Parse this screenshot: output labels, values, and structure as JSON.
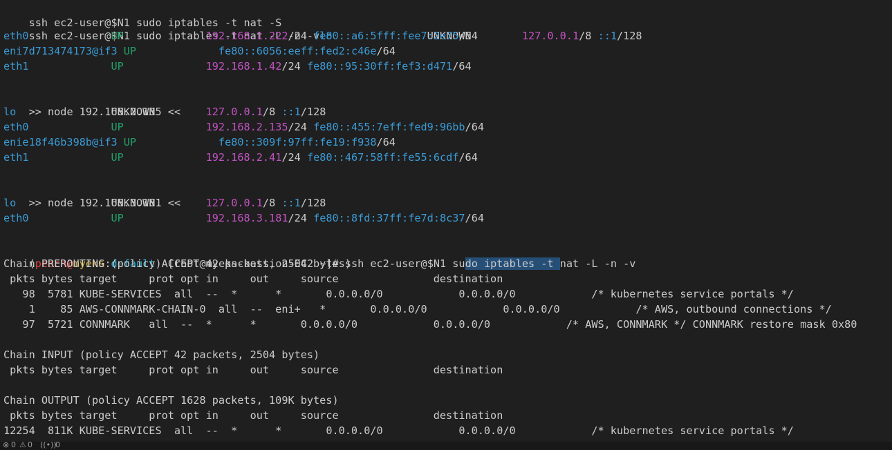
{
  "terminal": {
    "lines": [
      {
        "text": "ssh ec2-user@$N1 sudo iptables -t nat -S"
      },
      {
        "text": "ssh ec2-user@$N1 sudo iptables -t nat -L -n -v"
      },
      {
        "text": "eth0"
      },
      {
        "text": "eni7d713474173@if3"
      },
      {
        "text": "eth1"
      },
      {
        "text": ""
      },
      {
        "text": ">> node 192.168.2.135 <<"
      },
      {
        "text": "lo"
      },
      {
        "text": "eth0"
      },
      {
        "text": "enie18f46b398b@if3"
      },
      {
        "text": "eth1"
      },
      {
        "text": ""
      },
      {
        "text": ">> node 192.168.3.181 <<"
      },
      {
        "text": "lo"
      },
      {
        "text": "eth0"
      },
      {
        "text": ""
      },
      {
        "text": "(peach@myeks:default) [root@myeks-bastion-EC2 ~]# ssh ec2-user@$N1 sudo iptables -t nat -L -n -v"
      },
      {
        "text": "Chain PREROUTING (policy ACCEPT 42 packets, 2504 bytes)"
      },
      {
        "text": " pkts bytes target     prot opt in     out     source               destination"
      },
      {
        "text": "   98  5781 KUBE-SERVICES  all  --  *      *       0.0.0.0/0            0.0.0.0/0            /* kubernetes service portals */"
      },
      {
        "text": "    1    85 AWS-CONNMARK-CHAIN-0  all  --  eni+   *       0.0.0.0/0            0.0.0.0/0            /* AWS, outbound connections */"
      },
      {
        "text": "   97  5721 CONNMARK   all  --  *      *       0.0.0.0/0            0.0.0.0/0            /* AWS, CONNMARK */ CONNMARK restore mask 0x80"
      },
      {
        "text": ""
      },
      {
        "text": "Chain INPUT (policy ACCEPT 42 packets, 2504 bytes)"
      },
      {
        "text": " pkts bytes target     prot opt in     out     source               destination"
      },
      {
        "text": ""
      },
      {
        "text": "Chain OUTPUT (policy ACCEPT 1628 packets, 109K bytes)"
      },
      {
        "text": " pkts bytes target     prot opt in     out     source               destination"
      },
      {
        "text": "12254  811K KUBE-SERVICES  all  --  *      *       0.0.0.0/0            0.0.0.0/0            /* kubernetes service portals */"
      }
    ],
    "iface_table": {
      "line1": {
        "iface": "lo",
        "state": "UNKNOWN",
        "ip": "127.0.0.1",
        "mask": "/8",
        "v6": "::1",
        "v6mask": "/128"
      },
      "n1": [
        {
          "iface": "eth0",
          "state": "UP",
          "ip": "192.168.1.222",
          "mask": "/24",
          "v6": "fe80::a6:5fff:fee7:2e75",
          "v6mask": "/64"
        },
        {
          "iface": "eni7d713474173@if3",
          "state": "UP",
          "ip": "",
          "mask": "",
          "v6": "fe80::6056:eeff:fed2:c46e",
          "v6mask": "/64"
        },
        {
          "iface": "eth1",
          "state": "UP",
          "ip": "192.168.1.42",
          "mask": "/24",
          "v6": "fe80::95:30ff:fef3:d471",
          "v6mask": "/64"
        }
      ],
      "n2": [
        {
          "iface": "lo",
          "state": "UNKNOWN",
          "ip": "127.0.0.1",
          "mask": "/8",
          "v6": "::1",
          "v6mask": "/128"
        },
        {
          "iface": "eth0",
          "state": "UP",
          "ip": "192.168.2.135",
          "mask": "/24",
          "v6": "fe80::455:7eff:fed9:96bb",
          "v6mask": "/64"
        },
        {
          "iface": "enie18f46b398b@if3",
          "state": "UP",
          "ip": "",
          "mask": "",
          "v6": "fe80::309f:97ff:fe19:f938",
          "v6mask": "/64"
        },
        {
          "iface": "eth1",
          "state": "UP",
          "ip": "192.168.2.41",
          "mask": "/24",
          "v6": "fe80::467:58ff:fe55:6cdf",
          "v6mask": "/64"
        }
      ],
      "n3": [
        {
          "iface": "lo",
          "state": "UNKNOWN",
          "ip": "127.0.0.1",
          "mask": "/8",
          "v6": "::1",
          "v6mask": "/128"
        },
        {
          "iface": "eth0",
          "state": "UP",
          "ip": "192.168.3.181",
          "mask": "/24",
          "v6": "fe80::8fd:37ff:fe7d:8c37",
          "v6mask": "/64"
        }
      ]
    },
    "prompt": {
      "open_paren": "(",
      "user": "peach",
      "at": "@",
      "host": "myeks",
      "colon": ":",
      "ns": "default",
      "close": ")",
      "rest": " [root@myeks-bastion-EC2 ~]# ssh ec2-user@$N1 su",
      "selected": "do iptables -t ",
      "after": "nat -L -n -v"
    }
  },
  "statusbar": {
    "errors": "0",
    "warnings": "0",
    "ports": "0"
  },
  "colors": {
    "background": "#1f1f1f",
    "text": "#cccccc",
    "iface": "#3b9bd6",
    "up": "#23a06a",
    "ip": "#c353c3",
    "selection": "#264f78"
  }
}
